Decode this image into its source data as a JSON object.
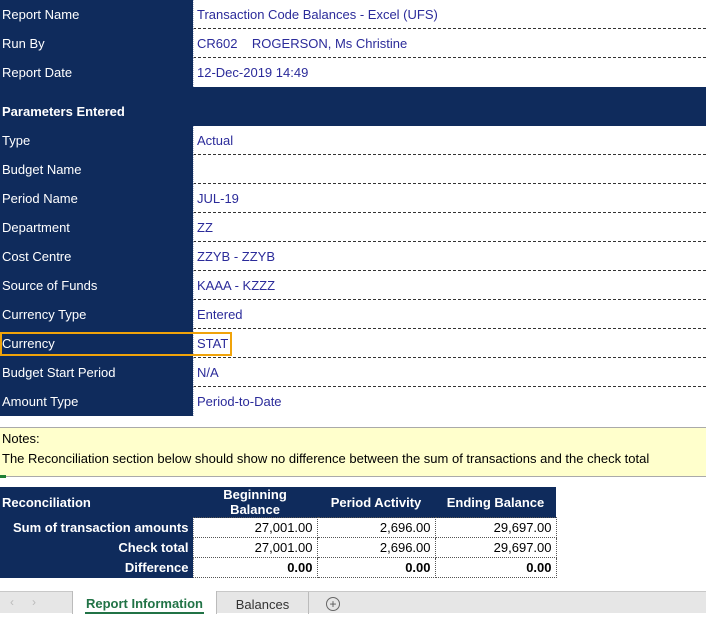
{
  "header": {
    "rows": [
      {
        "label": "Report Name",
        "value": "Transaction Code Balances - Excel (UFS)"
      },
      {
        "label": "Run By",
        "value": "CR602    ROGERSON, Ms Christine"
      },
      {
        "label": "Report Date",
        "value": "12-Dec-2019 14:49"
      }
    ]
  },
  "parameters": {
    "title": "Parameters Entered",
    "rows": [
      {
        "label": "Type",
        "value": "Actual"
      },
      {
        "label": "Budget Name",
        "value": ""
      },
      {
        "label": "Period Name",
        "value": "JUL-19"
      },
      {
        "label": "Department",
        "value": "ZZ"
      },
      {
        "label": "Cost Centre",
        "value": "ZZYB - ZZYB"
      },
      {
        "label": "Source of Funds",
        "value": "KAAA - KZZZ"
      },
      {
        "label": "Currency Type",
        "value": "Entered"
      },
      {
        "label": "Currency",
        "value": "STAT"
      },
      {
        "label": "Budget Start Period",
        "value": "N/A"
      },
      {
        "label": "Amount Type",
        "value": "Period-to-Date"
      }
    ]
  },
  "notes": {
    "title": "Notes:",
    "text": "The Reconciliation section below should show no difference between the sum of transactions and the check total"
  },
  "reconciliation": {
    "title": "Reconciliation",
    "columns": [
      "Beginning Balance",
      "Period Activity",
      "Ending Balance"
    ],
    "rows": [
      {
        "label": "Sum of transaction amounts",
        "values": [
          "27,001.00",
          "2,696.00",
          "29,697.00"
        ]
      },
      {
        "label": "Check total",
        "values": [
          "27,001.00",
          "2,696.00",
          "29,697.00"
        ]
      },
      {
        "label": "Difference",
        "values": [
          "0.00",
          "0.00",
          "0.00"
        ]
      }
    ]
  },
  "sheet_tabs": {
    "nav_prev": "‹",
    "nav_next": "›",
    "active": "Report Information",
    "other": "Balances",
    "add": "+"
  },
  "colors": {
    "header_navy": "#0f2b5c",
    "value_text": "#2b2b9a",
    "highlight_border": "#f0a30a",
    "notes_bg": "#ffffcc",
    "active_tab": "#217346"
  }
}
